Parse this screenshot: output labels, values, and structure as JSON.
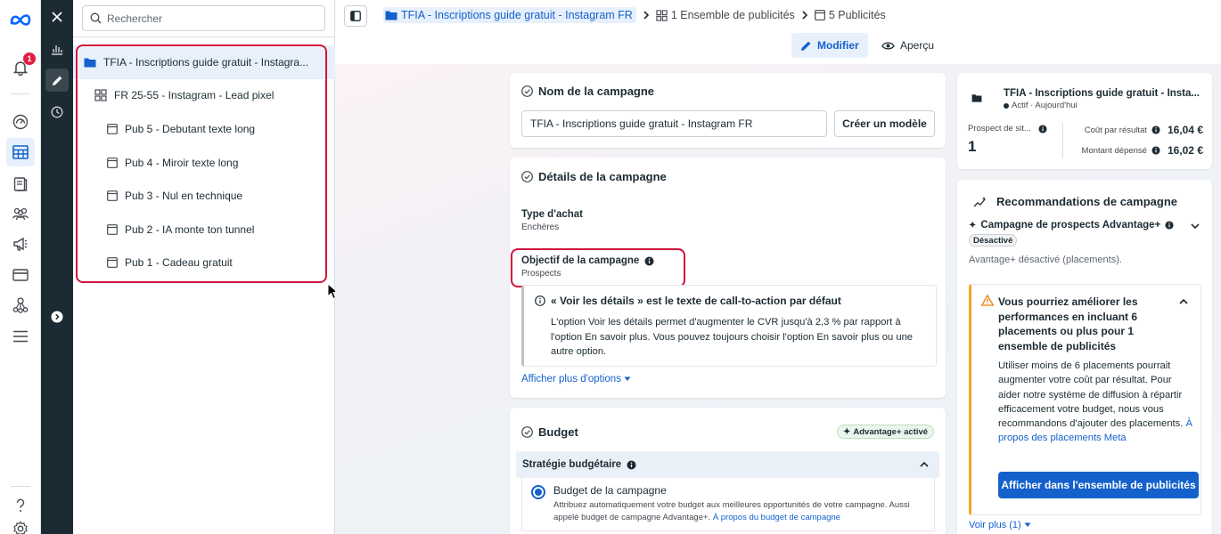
{
  "notifications": {
    "count": "1"
  },
  "tree": {
    "search_placeholder": "Rechercher",
    "items": [
      {
        "label": "TFIA - Inscriptions guide gratuit - Instagra...",
        "level": 0
      },
      {
        "label": "FR 25-55 - Instagram - Lead pixel",
        "level": 1
      },
      {
        "label": "Pub 5 - Debutant texte long",
        "level": 2
      },
      {
        "label": "Pub 4 - Miroir texte long",
        "level": 2
      },
      {
        "label": "Pub 3 - Nul en technique",
        "level": 2
      },
      {
        "label": "Pub 2 - IA monte ton tunnel",
        "level": 2
      },
      {
        "label": "Pub 1 - Cadeau gratuit",
        "level": 2
      }
    ]
  },
  "breadcrumb": {
    "campaign": "TFIA - Inscriptions guide gratuit - Instagram FR",
    "adsets": "1 Ensemble de publicités",
    "ads": "5 Publicités"
  },
  "toolbar": {
    "edit_label": "Modifier",
    "preview_label": "Aperçu"
  },
  "campaign_name": {
    "title": "Nom de la campagne",
    "value": "TFIA - Inscriptions guide gratuit - Instagram FR",
    "template_button": "Créer un modèle"
  },
  "campaign_details": {
    "title": "Détails de la campagne",
    "purchase_type_label": "Type d'achat",
    "purchase_type_value": "Enchères",
    "objective_label": "Objectif de la campagne",
    "objective_value": "Prospects",
    "info_title": "« Voir les détails » est le texte de call-to-action par défaut",
    "info_body": "L'option Voir les détails permet d'augmenter le CVR jusqu'à 2,3 % par rapport à l'option En savoir plus. Vous pouvez toujours choisir l'option En savoir plus ou une autre option.",
    "more_options": "Afficher plus d'options"
  },
  "budget": {
    "title": "Budget",
    "advantage_badge": "Advantage+ activé",
    "strategy_label": "Stratégie budgétaire",
    "option_label": "Budget de la campagne",
    "option_desc": "Attribuez automatiquement votre budget aux meilleures opportunités de votre campagne. Aussi appelé budget de campagne Advantage+.",
    "option_link": "À propos du budget de campagne"
  },
  "summary": {
    "name": "TFIA - Inscriptions guide gratuit - Insta...",
    "status": "Actif · Aujourd'hui",
    "metric_label": "Prospect de sit...",
    "metric_value": "1",
    "cpr_label": "Coût par résultat",
    "cpr_value": "16,04 €",
    "spent_label": "Montant dépensé",
    "spent_value": "16,02 €"
  },
  "recommendations": {
    "title": "Recommandations de campagne",
    "advantage_title": "Campagne de prospects Advantage+",
    "disabled_badge": "Désactivé",
    "advantage_note": "Avantage+ désactivé (placements).",
    "warn_title": "Vous pourriez améliorer les performances en incluant 6 placements ou plus pour 1 ensemble de publicités",
    "warn_body": "Utiliser moins de 6 placements pourrait augmenter votre coût par résultat. Pour aider notre système de diffusion à répartir efficacement votre budget, nous vous recommandons d'ajouter des placements.",
    "warn_link": "À propos des placements Meta",
    "cta": "Afficher dans l'ensemble de publicités",
    "see_more": "Voir plus (1)"
  },
  "colors": {
    "accent": "#1461cc",
    "highlight": "#d1123a",
    "warning": "#f5a623",
    "dark_rail": "#1c2b33"
  }
}
